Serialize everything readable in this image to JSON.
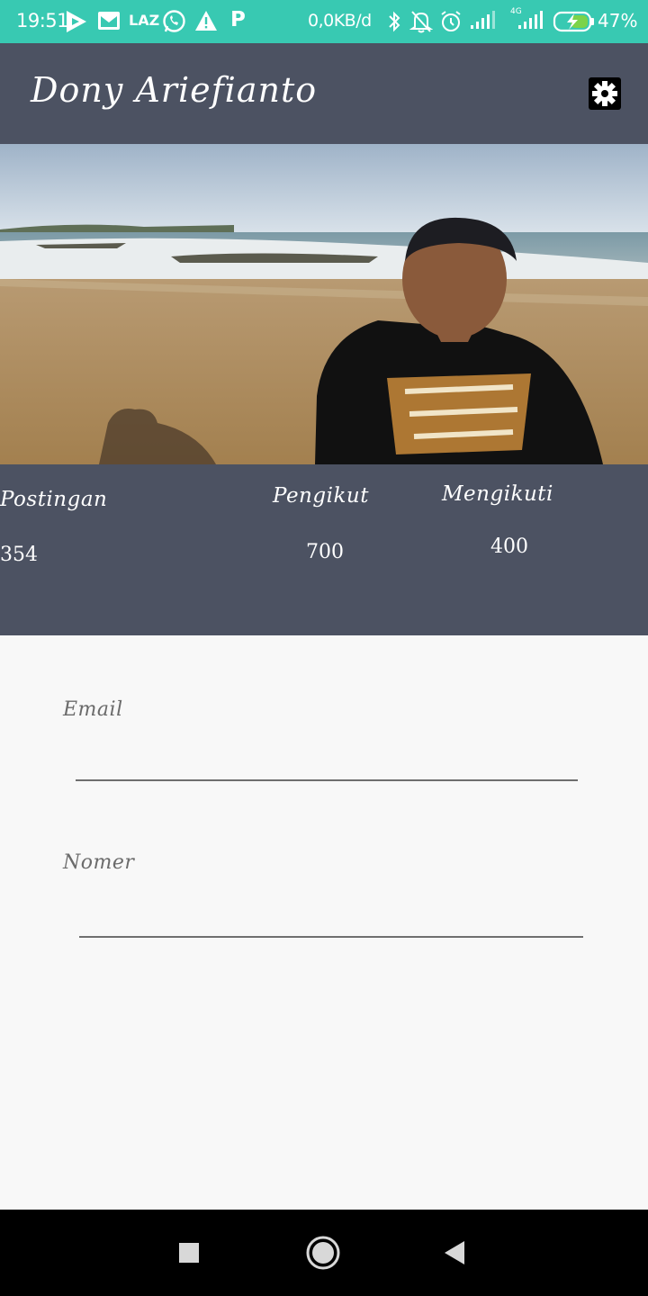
{
  "status_bar": {
    "time": "19:51",
    "net_speed": "0,0KB/d",
    "battery": "47%",
    "lte_label": "4G",
    "app_icons": [
      "play-icon",
      "mail-icon",
      "laz-icon",
      "whatsapp-icon",
      "warning-icon",
      "p-icon"
    ],
    "laz_label": "LAZ",
    "p_label": "P"
  },
  "app_bar": {
    "title": "Dony Ariefianto",
    "settings_icon": "gear-icon"
  },
  "stats": {
    "posts_label": "Postingan",
    "posts_value": "354",
    "followers_label": "Pengikut",
    "followers_value": "700",
    "following_label": "Mengikuti",
    "following_value": "400"
  },
  "form": {
    "email_label": "Email",
    "email_value": "",
    "phone_label": "Nomer",
    "phone_value": ""
  },
  "colors": {
    "status_bar": "#38c9b2",
    "app_bar": "#4c5262",
    "background": "#f8f8f8"
  }
}
